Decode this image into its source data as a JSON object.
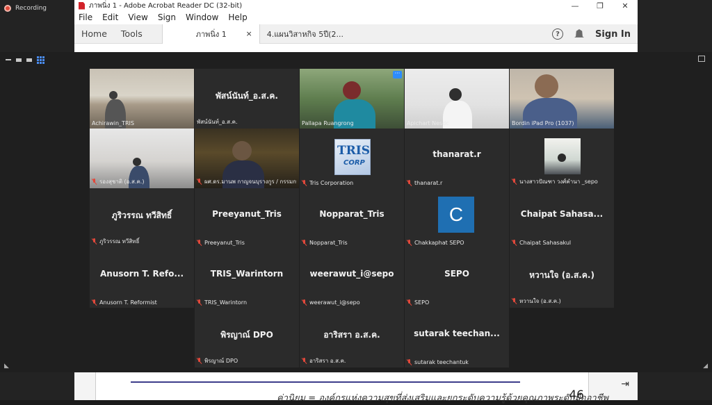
{
  "recording": {
    "label": "Recording"
  },
  "acrobat": {
    "title": "ภาพนิ่ง 1 - Adobe Acrobat Reader DC (32-bit)",
    "menu": [
      "File",
      "Edit",
      "View",
      "Sign",
      "Window",
      "Help"
    ],
    "home_tab": "Home",
    "tools_tab": "Tools",
    "active_doc": "ภาพนิ่ง 1",
    "other_doc": "4.แผนวิสาหกิจ 5ปี(2...",
    "sign_in": "Sign In",
    "close_glyph": "×",
    "doc_footer_text": "ค่านิยม  = องค์กรแห่งความสุขที่ส่งเสริมและยกระดับความรู้ด้วยคุณภาพระดับมืออาชีพ",
    "page_number": "46"
  },
  "zoom": {
    "tiles": [
      {
        "id": "achirawin",
        "name": "Achirawin_TRIS",
        "big": "",
        "muted": false,
        "kind": "video-office"
      },
      {
        "id": "pisannan",
        "name": "พัสน์นันท์_อ.ส.ค.",
        "big": "พัสน์นันท์_อ.ส.ค.",
        "muted": false,
        "kind": "name"
      },
      {
        "id": "pallapa",
        "name": "Pallapa Ruangrong",
        "big": "",
        "muted": false,
        "kind": "video-woman",
        "active": true
      },
      {
        "id": "apichart",
        "name": "Apichart Nesdc",
        "big": "",
        "muted": false,
        "kind": "video-mask"
      },
      {
        "id": "bordin",
        "name": "Bordin iPad Pro (1037)",
        "big": "",
        "muted": false,
        "kind": "video-bordin"
      },
      {
        "id": "rongsuchat",
        "name": "รองสุชาติ (อ.ส.ค.)",
        "big": "",
        "muted": true,
        "kind": "video-meeting"
      },
      {
        "id": "pasat",
        "name": "ผศ.ดร.มานพ กาญจนบุรางกูร / กรรมการ",
        "big": "",
        "muted": true,
        "kind": "video-dark"
      },
      {
        "id": "tris_corp",
        "name": "Tris Corporation",
        "big": "",
        "muted": true,
        "kind": "tris-logo"
      },
      {
        "id": "thanarat",
        "name": "thanarat.r",
        "big": "thanarat.r",
        "muted": true,
        "kind": "name"
      },
      {
        "id": "nangsao",
        "name": "นางสาวปัณฑา วงศ์คำนา _sepo",
        "big": "",
        "muted": true,
        "kind": "mini-photo"
      },
      {
        "id": "pureewan",
        "name": "ภูริวรรณ ทวีสิทธิ์",
        "big": "ภูริวรรณ ทวีสิทธิ์",
        "muted": true,
        "kind": "name"
      },
      {
        "id": "preeyanut",
        "name": "Preeyanut_Tris",
        "big": "Preeyanut_Tris",
        "muted": true,
        "kind": "name"
      },
      {
        "id": "nopparat",
        "name": "Nopparat_Tris",
        "big": "Nopparat_Tris",
        "muted": true,
        "kind": "name"
      },
      {
        "id": "chakkaphat",
        "name": "Chakkaphat SEPO",
        "big": "C",
        "muted": true,
        "kind": "avatar"
      },
      {
        "id": "chaipat",
        "name": "Chaipat Sahasakul",
        "big": "Chaipat  Sahasa...",
        "muted": true,
        "kind": "name"
      },
      {
        "id": "anusorn",
        "name": "Anusorn T. Reformist",
        "big": "Anusorn  T.  Refo...",
        "muted": true,
        "kind": "name"
      },
      {
        "id": "warintorn",
        "name": "TRIS_Warintorn",
        "big": "TRIS_Warintorn",
        "muted": true,
        "kind": "name"
      },
      {
        "id": "weerawut",
        "name": "weerawut_i@sepo",
        "big": "weerawut_i@sepo",
        "muted": true,
        "kind": "name"
      },
      {
        "id": "sepo",
        "name": "SEPO",
        "big": "SEPO",
        "muted": true,
        "kind": "name"
      },
      {
        "id": "wanjai",
        "name": "หวานใจ (อ.ส.ค.)",
        "big": "หวานใจ (อ.ส.ค.)",
        "muted": true,
        "kind": "name"
      },
      {
        "id": "pirayan",
        "name": "พิรญาณ์ DPO",
        "big": "พิรญาณ์ DPO",
        "muted": true,
        "kind": "name"
      },
      {
        "id": "arisara",
        "name": "อาริสรา  อ.ส.ค.",
        "big": "อาริสรา  อ.ส.ค.",
        "muted": true,
        "kind": "name"
      },
      {
        "id": "sutarak",
        "name": "sutarak teechantuk",
        "big": "sutarak  teechan...",
        "muted": true,
        "kind": "name"
      }
    ],
    "tris_logo_text": "TRIS",
    "tris_logo_sub": "CORP"
  }
}
